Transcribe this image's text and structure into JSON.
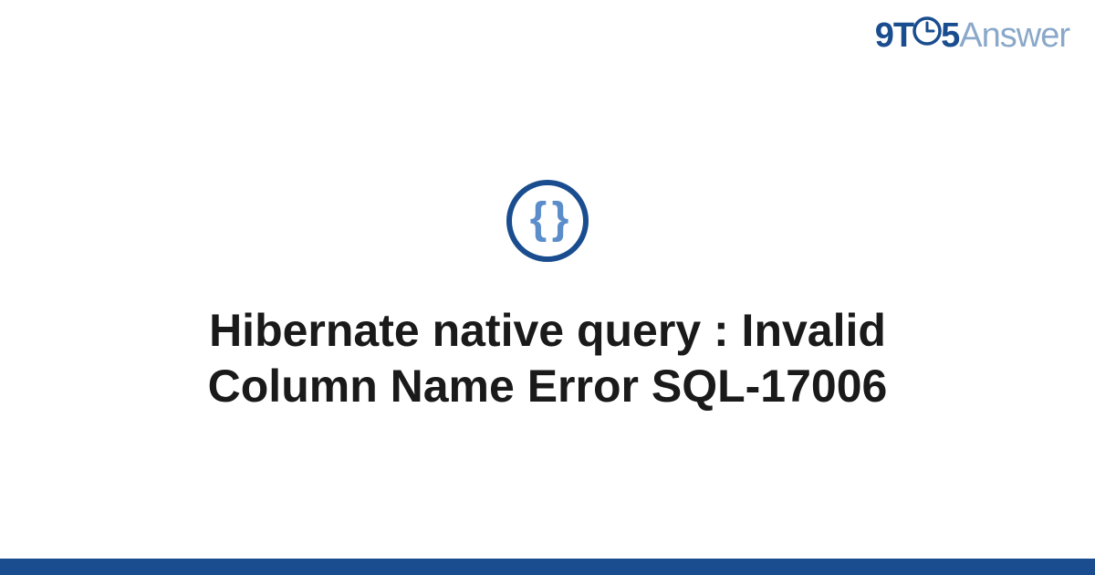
{
  "logo": {
    "part1": "9T",
    "part2": "5",
    "part3": "Answer"
  },
  "icon": {
    "name": "braces-icon",
    "glyph": "{ }"
  },
  "title": "Hibernate native query : Invalid Column Name Error SQL-17006",
  "colors": {
    "brand_primary": "#1a4d8f",
    "brand_secondary": "#8aa8c9",
    "icon_inner": "#5a8dc9"
  }
}
